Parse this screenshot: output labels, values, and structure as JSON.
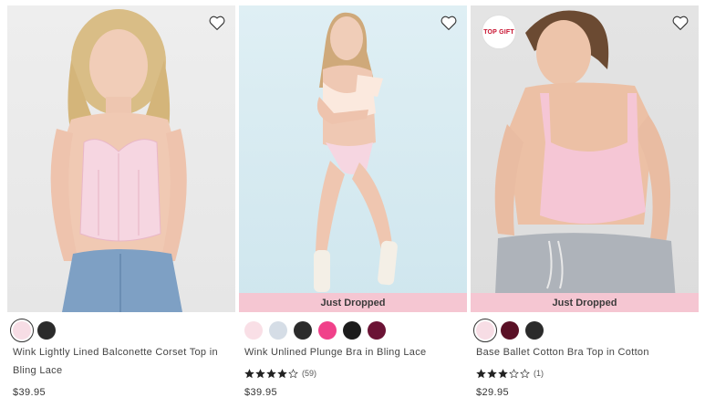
{
  "products": [
    {
      "name": "Wink Lightly Lined Balconette Corset Top in Bling Lace",
      "price": "$39.95",
      "swatches": [
        "#f7dde5",
        "#2b2b2b"
      ],
      "selected_swatch": 0,
      "rating": null,
      "review_count": null,
      "banner": "",
      "badge": "",
      "favorite_icon": "heart-outline-icon",
      "image_bg": "#ebebeb"
    },
    {
      "name": "Wink Unlined Plunge Bra in Bling Lace",
      "price": "$39.95",
      "swatches": [
        "#f9dfe6",
        "#d5dde6",
        "#2b2b2b",
        "#f0418a",
        "#1c1c1c",
        "#6b1335"
      ],
      "selected_swatch": null,
      "rating": 4,
      "review_count": "(59)",
      "banner": "Just Dropped",
      "badge": "",
      "favorite_icon": "heart-outline-icon",
      "image_bg": "#d6ebf1"
    },
    {
      "name": "Base Ballet Cotton Bra Top in Cotton",
      "price": "$29.95",
      "swatches": [
        "#f7dde5",
        "#5a1026",
        "#2b2b2b"
      ],
      "selected_swatch": 0,
      "rating": 3,
      "review_count": "(1)",
      "banner": "Just Dropped",
      "badge": "TOP GIFT",
      "favorite_icon": "heart-outline-icon",
      "image_bg": "#e0e0e0"
    }
  ],
  "colors": {
    "banner_bg": "#f5c6d2",
    "badge_text": "#c8102e",
    "star_fill": "#222222"
  }
}
